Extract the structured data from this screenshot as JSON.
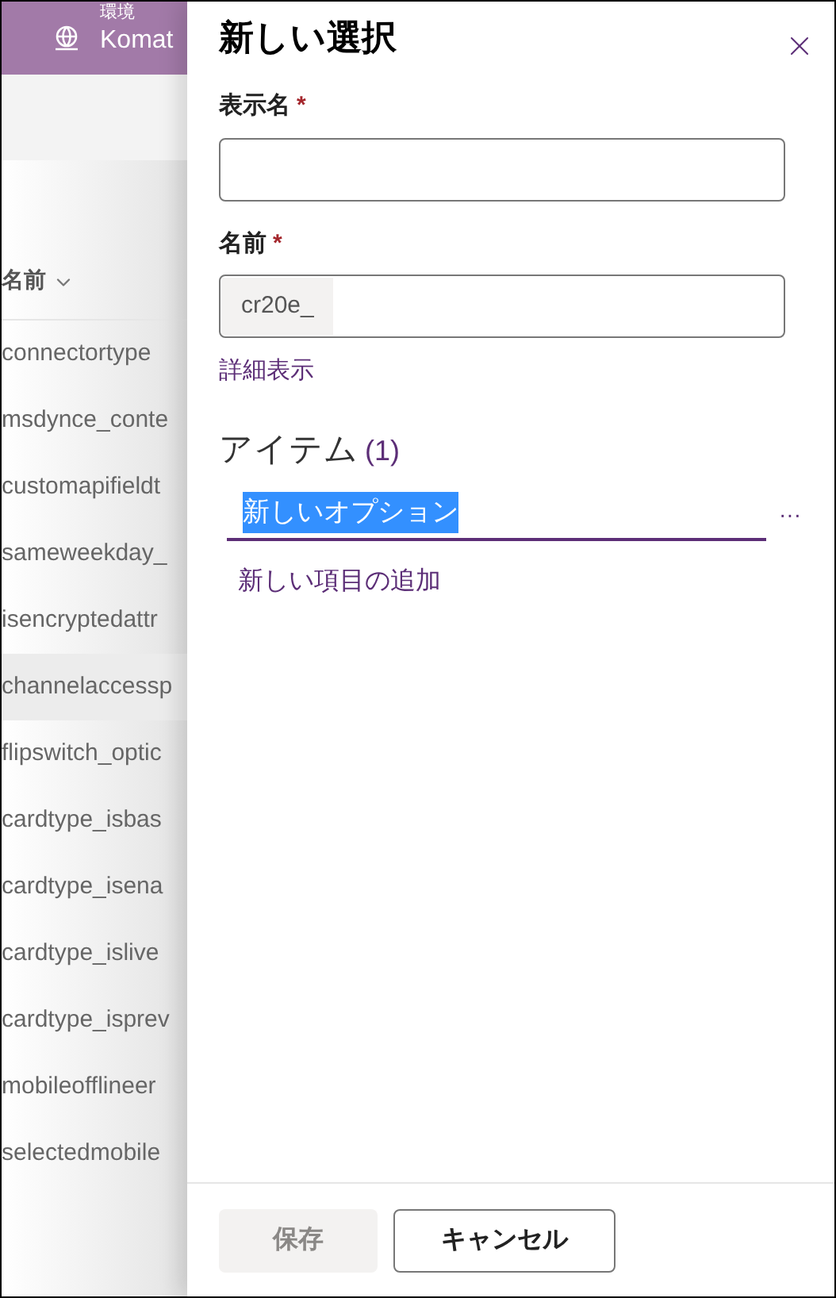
{
  "header": {
    "label": "環境",
    "environment": "Komat"
  },
  "list": {
    "column": "名前",
    "rows": [
      {
        "name": "connectortype",
        "selected": false
      },
      {
        "name": "msdynce_conte",
        "selected": false
      },
      {
        "name": "customapifieldt",
        "selected": false
      },
      {
        "name": "sameweekday_",
        "selected": false
      },
      {
        "name": "isencryptedattr",
        "selected": false
      },
      {
        "name": "channelaccessp",
        "selected": true
      },
      {
        "name": "flipswitch_optic",
        "selected": false
      },
      {
        "name": "cardtype_isbas",
        "selected": false
      },
      {
        "name": "cardtype_isena",
        "selected": false
      },
      {
        "name": "cardtype_islive",
        "selected": false
      },
      {
        "name": "cardtype_isprev",
        "selected": false
      },
      {
        "name": "mobileofflineer",
        "selected": false
      },
      {
        "name": "selectedmobile",
        "selected": false
      }
    ]
  },
  "panel": {
    "title": "新しい選択",
    "display_name": {
      "label": "表示名",
      "required_mark": "*"
    },
    "name": {
      "label": "名前",
      "required_mark": "*",
      "prefix": "cr20e_"
    },
    "advanced_link": "詳細表示",
    "items": {
      "heading": "アイテム",
      "count": "(1)",
      "options": [
        {
          "label": "新しいオプション",
          "selected": true,
          "menu": "···"
        }
      ],
      "add_link": "新しい項目の追加"
    },
    "buttons": [
      {
        "label": "保存",
        "disabled": true
      },
      {
        "label": "キャンセル",
        "disabled": false
      }
    ]
  }
}
